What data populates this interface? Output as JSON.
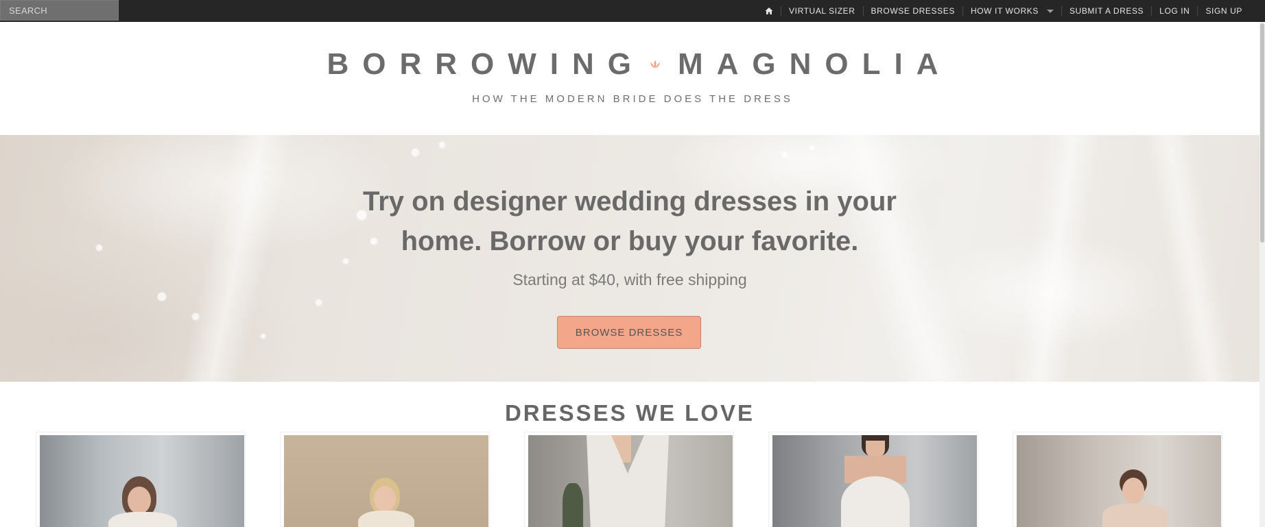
{
  "search": {
    "placeholder": "SEARCH"
  },
  "nav": {
    "home_icon": "home-icon",
    "items": [
      "VIRTUAL SIZER",
      "BROWSE DRESSES",
      "HOW IT WORKS",
      "SUBMIT A DRESS",
      "LOG IN",
      "SIGN UP"
    ]
  },
  "logo": {
    "word1": "BORROWING",
    "word2": "MAGNOLIA",
    "flower_icon": "magnolia-flower-icon",
    "flower_color": "#f0a080",
    "tagline": "HOW THE MODERN BRIDE DOES THE DRESS"
  },
  "hero": {
    "title_line1": "Try on designer wedding dresses in your",
    "title_line2": "home. Borrow or buy your favorite.",
    "subtitle": "Starting at $40, with free shipping",
    "button_label": "BROWSE DRESSES",
    "button_color": "#f4a68b"
  },
  "section": {
    "title": "DRESSES WE LOVE",
    "dresses": [
      {
        "name": "dress-card-1"
      },
      {
        "name": "dress-card-2"
      },
      {
        "name": "dress-card-3"
      },
      {
        "name": "dress-card-4"
      },
      {
        "name": "dress-card-5"
      }
    ]
  }
}
